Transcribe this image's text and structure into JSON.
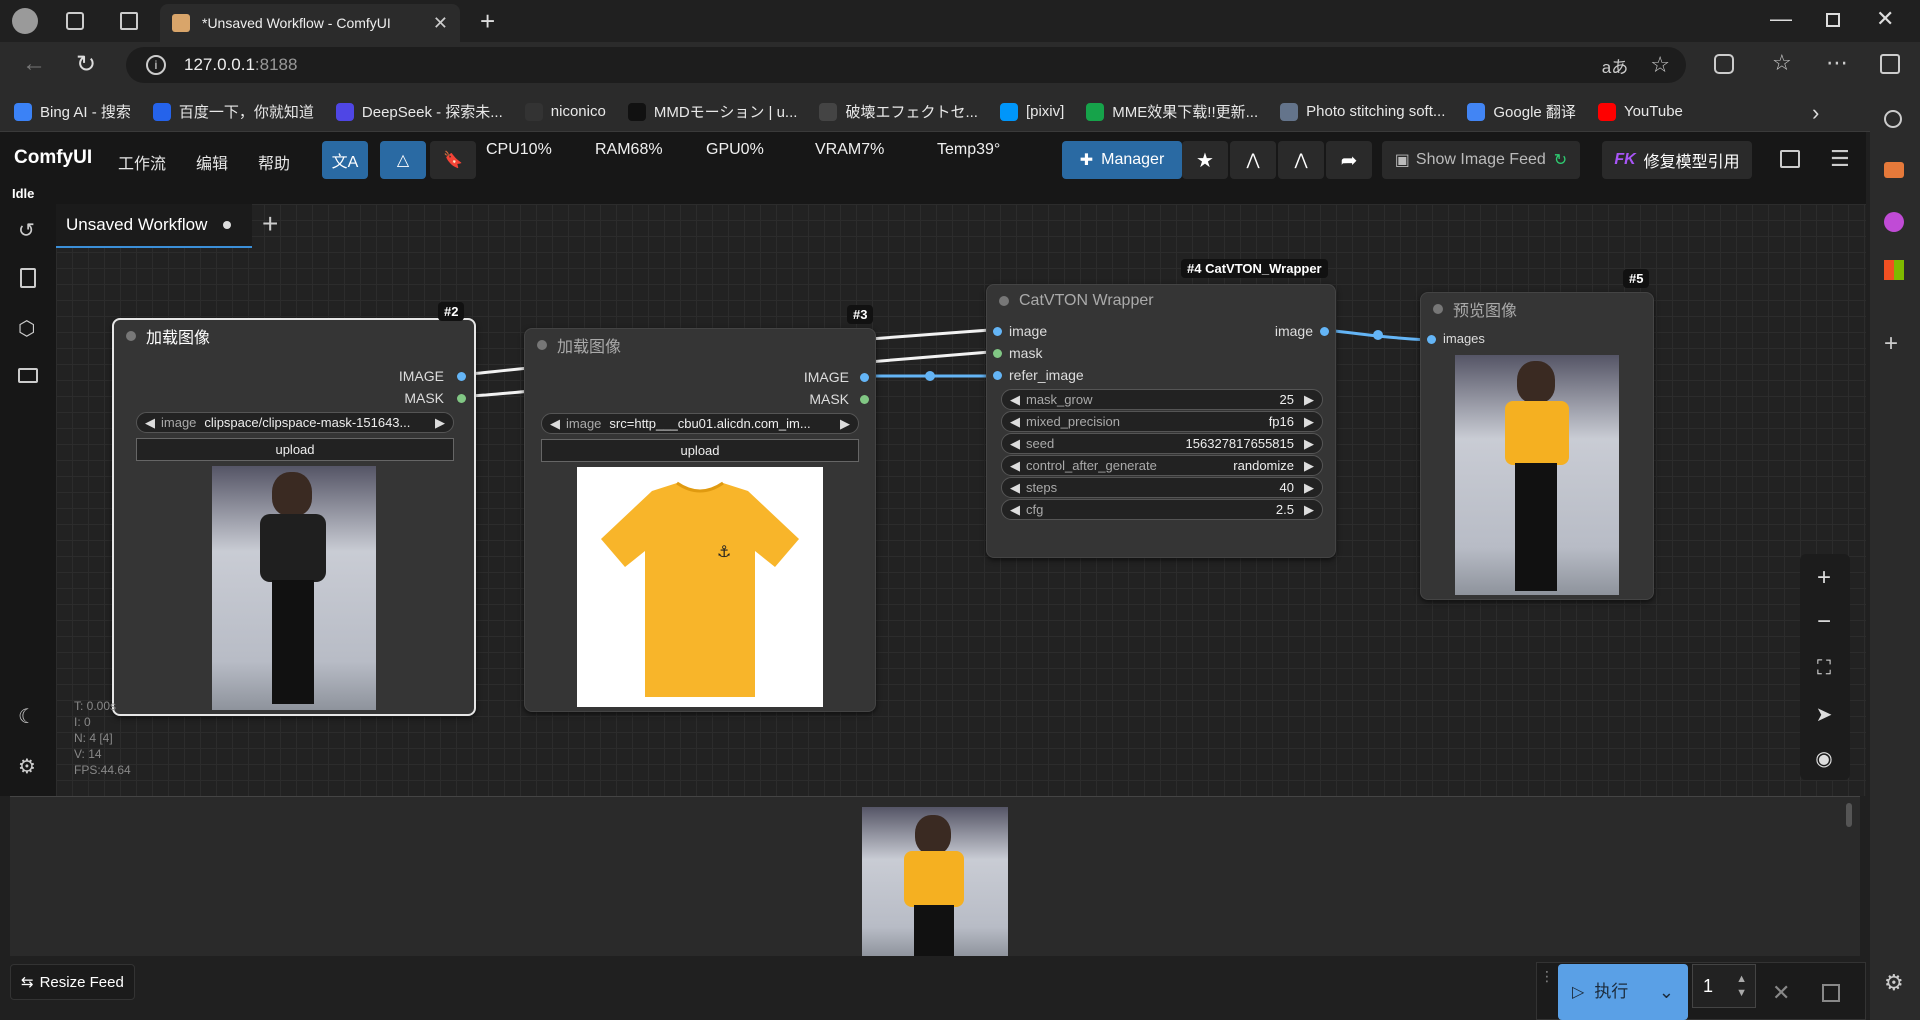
{
  "browser": {
    "tab_title": "*Unsaved Workflow - ComfyUI",
    "url_host": "127.0.0.1",
    "url_port": ":8188",
    "bookmarks": [
      {
        "label": "Bing AI - 搜索",
        "color": "#3b82f6"
      },
      {
        "label": "百度一下，你就知道",
        "color": "#2563eb"
      },
      {
        "label": "DeepSeek - 探索未...",
        "color": "#4f46e5"
      },
      {
        "label": "niconico",
        "color": "#333333"
      },
      {
        "label": "MMDモーション | u...",
        "color": "#111111"
      },
      {
        "label": "破壊エフェクトセ...",
        "color": "#444444"
      },
      {
        "label": "[pixiv]",
        "color": "#0096fa"
      },
      {
        "label": "MME效果下载!!更新...",
        "color": "#16a34a"
      },
      {
        "label": "Photo stitching soft...",
        "color": "#64748b"
      },
      {
        "label": "Google 翻译",
        "color": "#4285f4"
      },
      {
        "label": "YouTube",
        "color": "#ff0000"
      }
    ]
  },
  "menu": {
    "logo": "ComfyUI",
    "items": [
      "工作流",
      "编辑",
      "帮助"
    ],
    "stats": {
      "cpu": "CPU10%",
      "ram": "RAM68%",
      "gpu": "GPU0%",
      "vram": "VRAM7%",
      "temp": "Temp39°"
    },
    "manager": "Manager",
    "show_feed": "Show Image Feed",
    "fix_models": "修复模型引用",
    "fk": "FK"
  },
  "status": "Idle",
  "workflow_tab": "Unsaved Workflow",
  "nodes": {
    "n2": {
      "badge": "#2",
      "title": "加载图像",
      "out_image": "IMAGE",
      "out_mask": "MASK",
      "widget_label": "image",
      "widget_value": "clipspace/clipspace-mask-151643...",
      "upload": "upload"
    },
    "n3": {
      "badge": "#3",
      "title": "加载图像",
      "out_image": "IMAGE",
      "out_mask": "MASK",
      "widget_label": "image",
      "widget_value": "src=http___cbu01.alicdn.com_im...",
      "upload": "upload"
    },
    "n4": {
      "badge": "#4 CatVTON_Wrapper",
      "title": "CatVTON Wrapper",
      "inputs": [
        "image",
        "mask",
        "refer_image"
      ],
      "output": "image",
      "widgets": [
        {
          "label": "mask_grow",
          "value": "25"
        },
        {
          "label": "mixed_precision",
          "value": "fp16"
        },
        {
          "label": "seed",
          "value": "156327817655815"
        },
        {
          "label": "control_after_generate",
          "value": "randomize"
        },
        {
          "label": "steps",
          "value": "40"
        },
        {
          "label": "cfg",
          "value": "2.5"
        }
      ]
    },
    "n5": {
      "badge": "#5",
      "title": "预览图像",
      "input": "images"
    }
  },
  "canvas_info": [
    "T: 0.00s",
    "I: 0",
    "N: 4 [4]",
    "V: 14",
    "FPS:44.64"
  ],
  "bottom": {
    "resize_feed": "Resize Feed",
    "run": "执行",
    "run2": "行",
    "batch": "1"
  }
}
